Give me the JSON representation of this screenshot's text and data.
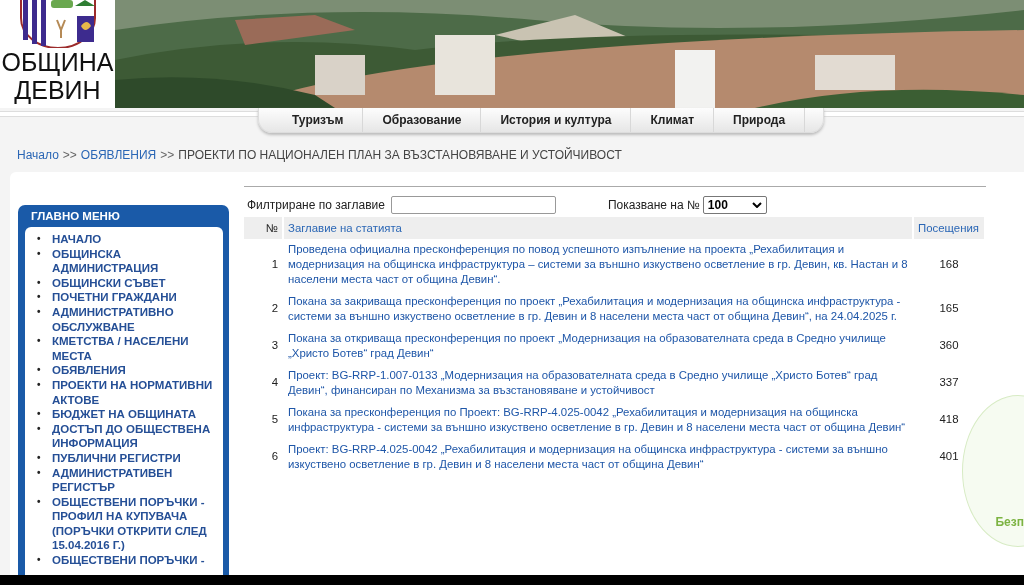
{
  "logo": {
    "lines": [
      "ОБЩИНА",
      "ДЕВИН"
    ]
  },
  "nav": [
    "Туризъм",
    "Образование",
    "История и култура",
    "Климат",
    "Природа"
  ],
  "breadcrumb": {
    "links": [
      "Начало",
      "ОБЯВЛЕНИЯ"
    ],
    "separator": ">>",
    "current": "ПРОЕКТИ ПО НАЦИОНАЛЕН ПЛАН ЗА ВЪЗСТАНОВЯВАНЕ И УСТОЙЧИВОСТ"
  },
  "sidebar": {
    "title": "ГЛАВНО МЕНЮ",
    "bullet": "•",
    "items": [
      "НАЧАЛО",
      "ОБЩИНСКА АДМИНИСТРАЦИЯ",
      "ОБЩИНСКИ СЪВЕТ",
      "ПОЧЕТНИ ГРАЖДАНИ",
      "АДМИНИСТРАТИВНО ОБСЛУЖВАНЕ",
      "КМЕТСТВА / НАСЕЛЕНИ МЕСТА",
      "ОБЯВЛЕНИЯ",
      "ПРОЕКТИ НА НОРМАТИВНИ АКТОВЕ",
      "БЮДЖЕТ НА ОБЩИНАТА",
      "ДОСТЪП ДО ОБЩЕСТВЕНА ИНФОРМАЦИЯ",
      "ПУБЛИЧНИ РЕГИСТРИ",
      "АДМИНИСТРАТИВЕН РЕГИСТЪР",
      "ОБЩЕСТВЕНИ ПОРЪЧКИ - ПРОФИЛ НА КУПУВАЧА (ПОРЪЧКИ ОТКРИТИ СЛЕД 15.04.2016 Г.)",
      "ОБЩЕСТВЕНИ ПОРЪЧКИ -"
    ]
  },
  "filter": {
    "label": "Филтриране по заглавие"
  },
  "page_size": {
    "label": "Показване на №",
    "value": "100"
  },
  "table": {
    "columns": [
      "№",
      "Заглавие на статията",
      "Посещения"
    ],
    "rows": [
      {
        "number": "1",
        "title": "Проведена официална пресконференция по повод успешното изпълнение на проекта „Рехабилитация и модернизация на общинска инфраструктура – системи за външно изкуствено осветление в гр. Девин, кв. Настан и 8 населени места част от община Девин“.",
        "visits": "168"
      },
      {
        "number": "2",
        "title": "Покана за закриваща пресконференция по проект „Рехабилитация и модернизация на общинска инфраструктура - системи за външно изкуствено осветление в гр. Девин и 8 населени места част от община Девин“, на 24.04.2025 г.",
        "visits": "165"
      },
      {
        "number": "3",
        "title": "Покана за откриваща пресконференция по проект „Модернизация на образователната среда в Средно училище „Христо Ботев“ град Девин“",
        "visits": "360"
      },
      {
        "number": "4",
        "title": "Проект: BG-RRP-1.007-0133 „Модернизация на образователната среда в Средно училище „Христо Ботев“ град Девин“, финансиран по Механизма за възстановяване и устойчивост",
        "visits": "337"
      },
      {
        "number": "5",
        "title": "Покана за пресконференция по Проект: BG-RRP-4.025-0042 „Рехабилитация и модернизация на общинска инфраструктура - системи за външно изкуствено осветление в гр. Девин и 8 населени места част от община Девин“",
        "visits": "418"
      },
      {
        "number": "6",
        "title": "Проект: BG-RRP-4.025-0042 „Рехабилитация и модернизация на общинска инфраструктура - системи за външно изкуствено осветление в гр. Девин и 8 населени места част от община Девин“",
        "visits": "401"
      }
    ]
  },
  "side_widget": {
    "text": "Безп"
  }
}
